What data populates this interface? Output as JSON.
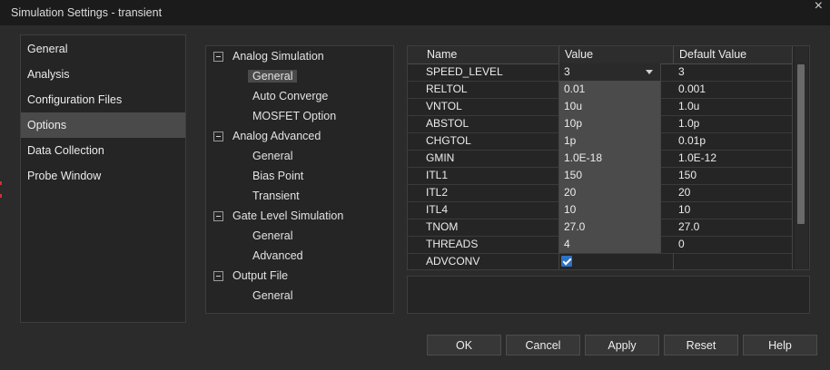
{
  "window": {
    "title": "Simulation Settings - transient",
    "close_glyph": "×"
  },
  "categories": [
    {
      "label": "General",
      "active": false
    },
    {
      "label": "Analysis",
      "active": false
    },
    {
      "label": "Configuration Files",
      "active": false
    },
    {
      "label": "Options",
      "active": true
    },
    {
      "label": "Data Collection",
      "active": false
    },
    {
      "label": "Probe Window",
      "active": false
    }
  ],
  "tree": [
    {
      "label": "Analog Simulation",
      "level": 0,
      "expanded": true
    },
    {
      "label": "General",
      "level": 1,
      "selected": true
    },
    {
      "label": "Auto Converge",
      "level": 1
    },
    {
      "label": "MOSFET Option",
      "level": 1
    },
    {
      "label": "Analog Advanced",
      "level": 0,
      "expanded": true
    },
    {
      "label": "General",
      "level": 1
    },
    {
      "label": "Bias Point",
      "level": 1
    },
    {
      "label": "Transient",
      "level": 1
    },
    {
      "label": "Gate Level Simulation",
      "level": 0,
      "expanded": true
    },
    {
      "label": "General",
      "level": 1
    },
    {
      "label": "Advanced",
      "level": 1
    },
    {
      "label": "Output File",
      "level": 0,
      "expanded": true
    },
    {
      "label": "General",
      "level": 1
    }
  ],
  "grid": {
    "headers": {
      "name": "Name",
      "value": "Value",
      "default": "Default Value"
    },
    "rows": [
      {
        "name": "SPEED_LEVEL",
        "value": "3",
        "default": "3",
        "kind": "combo"
      },
      {
        "name": "RELTOL",
        "value": "0.01",
        "default": "0.001",
        "kind": "text"
      },
      {
        "name": "VNTOL",
        "value": "10u",
        "default": "1.0u",
        "kind": "text"
      },
      {
        "name": "ABSTOL",
        "value": "10p",
        "default": "1.0p",
        "kind": "text"
      },
      {
        "name": "CHGTOL",
        "value": "1p",
        "default": "0.01p",
        "kind": "text"
      },
      {
        "name": "GMIN",
        "value": "1.0E-18",
        "default": "1.0E-12",
        "kind": "text"
      },
      {
        "name": "ITL1",
        "value": "150",
        "default": "150",
        "kind": "text"
      },
      {
        "name": "ITL2",
        "value": "20",
        "default": "20",
        "kind": "text"
      },
      {
        "name": "ITL4",
        "value": "10",
        "default": "10",
        "kind": "text"
      },
      {
        "name": "TNOM",
        "value": "27.0",
        "default": "27.0",
        "kind": "text"
      },
      {
        "name": "THREADS",
        "value": "4",
        "default": "0",
        "kind": "text"
      },
      {
        "name": "ADVCONV",
        "value": "",
        "default": "",
        "kind": "checkbox",
        "checked": true
      }
    ]
  },
  "buttons": {
    "ok": "OK",
    "cancel": "Cancel",
    "apply": "Apply",
    "reset": "Reset",
    "help": "Help"
  },
  "colors": {
    "accent": "#2d72c4",
    "selected_bg": "#4a4a4a",
    "window_bg": "#2b2b2b"
  }
}
